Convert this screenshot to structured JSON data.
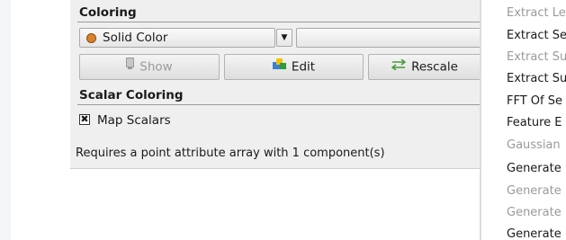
{
  "coloring": {
    "title": "Coloring",
    "color_mode": "Solid Color",
    "buttons": {
      "show": "Show",
      "edit": "Edit",
      "rescale": "Rescale"
    }
  },
  "scalar_coloring": {
    "title": "Scalar Coloring",
    "map_scalars_label": "Map Scalars",
    "map_scalars_checked": true
  },
  "requirement_text": "Requires a point attribute array with 1 component(s)",
  "filter_list": [
    {
      "label": "Extract Le",
      "enabled": false
    },
    {
      "label": "Extract Se",
      "enabled": true
    },
    {
      "label": "Extract Su",
      "enabled": false
    },
    {
      "label": "Extract Su",
      "enabled": true
    },
    {
      "label": "FFT Of Se",
      "enabled": true
    },
    {
      "label": "Feature E",
      "enabled": true
    },
    {
      "label": "Gaussian",
      "enabled": false
    },
    {
      "label": "Generate",
      "enabled": true
    },
    {
      "label": "Generate",
      "enabled": false
    },
    {
      "label": "Generate",
      "enabled": false
    },
    {
      "label": "Generate",
      "enabled": true
    }
  ],
  "colors": {
    "solid_color_swatch": "#d9822b",
    "disabled_text": "#9a9a9a"
  },
  "icons": {
    "show": "monitor-icon",
    "edit": "palette-edit-icon",
    "rescale": "rescale-arrows-icon",
    "dropdown": "chevron-down-icon"
  }
}
